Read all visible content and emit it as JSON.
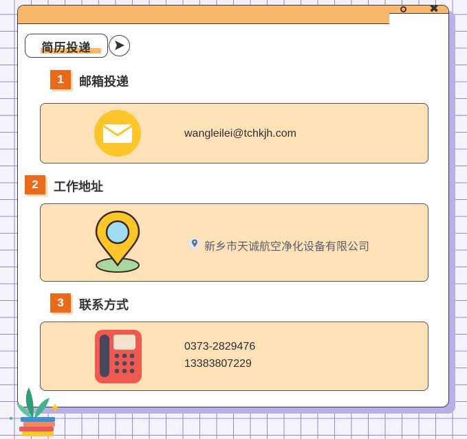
{
  "colors": {
    "accent": "#f8b86b",
    "badge": "#e86a1a",
    "card": "#ffe1b8",
    "grid": "#8e86d8"
  },
  "window": {
    "controls": [
      "restore-icon",
      "close-icon"
    ]
  },
  "tab": {
    "label": "简历投递",
    "arrow_icon": "arrow-right-icon"
  },
  "sections": [
    {
      "number": "1",
      "title": "邮箱投递",
      "icon": "envelope-icon",
      "lines": [
        "wangleilei@tchkjh.com"
      ]
    },
    {
      "number": "2",
      "title": "工作地址",
      "icon": "map-pin-icon",
      "inline_icon": "location-pin-icon",
      "lines": [
        "新乡市天诚航空净化设备有限公司"
      ]
    },
    {
      "number": "3",
      "title": "联系方式",
      "icon": "telephone-icon",
      "lines": [
        "0373-2829476",
        "13383807229"
      ]
    }
  ]
}
